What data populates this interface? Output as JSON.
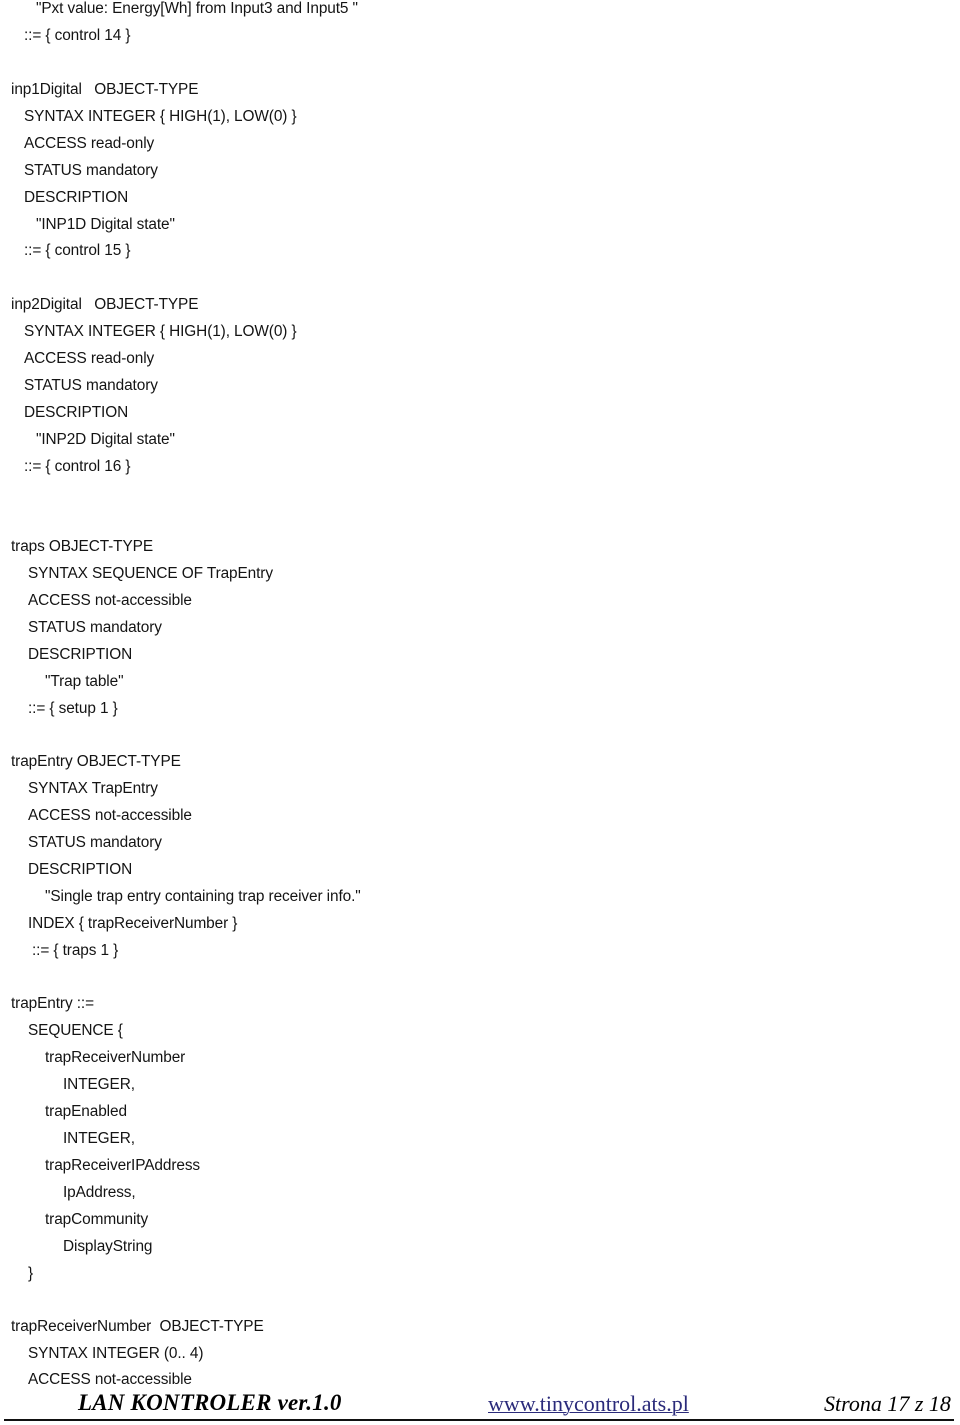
{
  "document": {
    "lines": [
      "\"Pxt value: Energy[Wh] from Input3 and Input5 \"",
      "::= { control 14 }",
      "inp1Digital   OBJECT-TYPE",
      "SYNTAX INTEGER { HIGH(1), LOW(0) }",
      "ACCESS read-only",
      "STATUS mandatory",
      "DESCRIPTION",
      "\"INP1D Digital state\"",
      "::= { control 15 }",
      "inp2Digital   OBJECT-TYPE",
      "SYNTAX INTEGER { HIGH(1), LOW(0) }",
      "ACCESS read-only",
      "STATUS mandatory",
      "DESCRIPTION",
      "\"INP2D Digital state\"",
      "::= { control 16 }",
      "traps OBJECT-TYPE",
      "SYNTAX SEQUENCE OF TrapEntry",
      "ACCESS not-accessible",
      "STATUS mandatory",
      "DESCRIPTION",
      "\"Trap table\"",
      "::= { setup 1 }",
      "trapEntry OBJECT-TYPE",
      "SYNTAX TrapEntry",
      "ACCESS not-accessible",
      "STATUS mandatory",
      "DESCRIPTION",
      "\"Single trap entry containing trap receiver info.\"",
      "INDEX { trapReceiverNumber }",
      "::= { traps 1 }",
      "trapEntry ::=",
      "SEQUENCE {",
      "trapReceiverNumber",
      "INTEGER,",
      "trapEnabled",
      "INTEGER,",
      "trapReceiverIPAddress",
      "IpAddress,",
      "trapCommunity",
      "DisplayString",
      "}",
      "trapReceiverNumber  OBJECT-TYPE",
      "SYNTAX INTEGER (0.. 4)",
      "ACCESS not-accessible"
    ]
  },
  "footer": {
    "title": "LAN KONTROLER  ver.1.0",
    "link": "www.tinycontrol.ats.pl",
    "page": "Strona 17 z 18",
    "link_color": "#2a2a7a"
  }
}
